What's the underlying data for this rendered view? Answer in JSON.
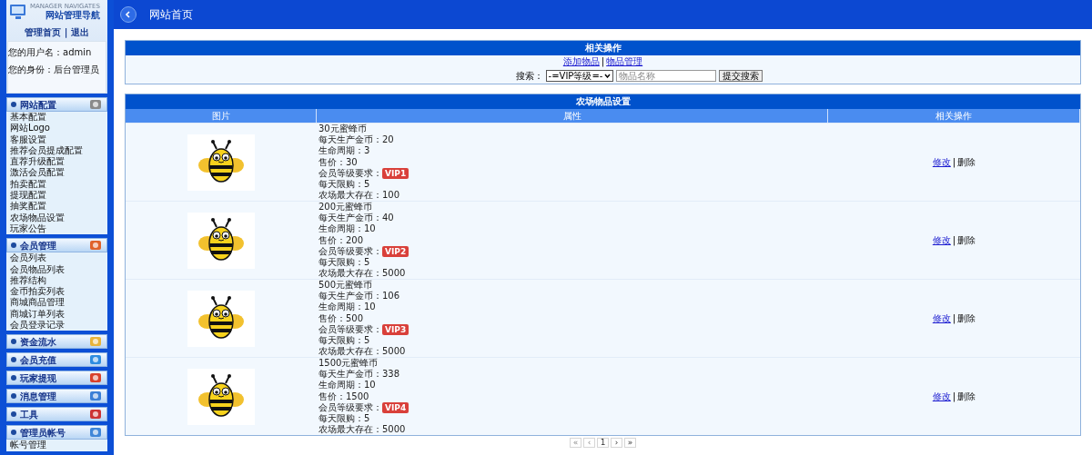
{
  "sidebar": {
    "subtitle": "MANAGER NAVIGATES",
    "title": "网站管理导航",
    "links": [
      "管理首页",
      "退出"
    ],
    "link_separator": "|",
    "user_lines": [
      "您的用户名：admin",
      "您的身份：后台管理员"
    ],
    "sections": [
      {
        "title": "网站配置",
        "items": [
          "基本配置",
          "网站Logo",
          "客服设置",
          "推荐会员提成配置",
          "直荐升级配置",
          "激活会员配置",
          "拍卖配置",
          "提现配置",
          "抽奖配置",
          "农场物品设置",
          "玩家公告"
        ]
      },
      {
        "title": "会员管理",
        "items": [
          "会员列表",
          "会员物品列表",
          "推荐结构",
          "金币拍卖列表",
          "商城商品管理",
          "商城订单列表",
          "会员登录记录"
        ]
      },
      {
        "title": "资金流水"
      },
      {
        "title": "会员充值"
      },
      {
        "title": "玩家提现"
      },
      {
        "title": "消息管理"
      },
      {
        "title": "工具"
      },
      {
        "title": "管理员帐号",
        "items": [
          "帐号管理"
        ]
      }
    ]
  },
  "header": {
    "title": "网站首页"
  },
  "operations": {
    "title": "相关操作",
    "links": [
      "添加物品",
      "物品管理"
    ],
    "link_separator": "|",
    "search_label": "搜索：",
    "select_value": "-=VIP等级=-",
    "search": {
      "placeholder": "物品名称"
    },
    "submit": "提交搜索"
  },
  "table": {
    "title": "农场物品设置",
    "columns": [
      "图片",
      "属性",
      "相关操作"
    ],
    "action_separator": "|",
    "rows": [
      {
        "lines": [
          {
            "kind": "text",
            "text": "30元蜜蜂币"
          },
          {
            "kind": "text",
            "text": "每天生产金币：20"
          },
          {
            "kind": "text",
            "text": "生命周期：3"
          },
          {
            "kind": "text",
            "text": "售价：30"
          },
          {
            "kind": "badge",
            "text": "会员等级要求：",
            "badge": "VIP1"
          },
          {
            "kind": "text",
            "text": "每天限购：5"
          },
          {
            "kind": "text",
            "text": "农场最大存在：100"
          }
        ],
        "actions": [
          {
            "kind": "link",
            "text": "修改"
          },
          {
            "kind": "text",
            "text": "删除"
          }
        ]
      },
      {
        "lines": [
          {
            "kind": "text",
            "text": "200元蜜蜂币"
          },
          {
            "kind": "text",
            "text": "每天生产金币：40"
          },
          {
            "kind": "text",
            "text": "生命周期：10"
          },
          {
            "kind": "text",
            "text": "售价：200"
          },
          {
            "kind": "badge",
            "text": "会员等级要求：",
            "badge": "VIP2"
          },
          {
            "kind": "text",
            "text": "每天限购：5"
          },
          {
            "kind": "text",
            "text": "农场最大存在：5000"
          }
        ],
        "actions": [
          {
            "kind": "link",
            "text": "修改"
          },
          {
            "kind": "text",
            "text": "删除"
          }
        ]
      },
      {
        "lines": [
          {
            "kind": "text",
            "text": "500元蜜蜂币"
          },
          {
            "kind": "text",
            "text": "每天生产金币：106"
          },
          {
            "kind": "text",
            "text": "生命周期：10"
          },
          {
            "kind": "text",
            "text": "售价：500"
          },
          {
            "kind": "badge",
            "text": "会员等级要求：",
            "badge": "VIP3"
          },
          {
            "kind": "text",
            "text": "每天限购：5"
          },
          {
            "kind": "text",
            "text": "农场最大存在：5000"
          }
        ],
        "actions": [
          {
            "kind": "link",
            "text": "修改"
          },
          {
            "kind": "text",
            "text": "删除"
          }
        ]
      },
      {
        "lines": [
          {
            "kind": "text",
            "text": "1500元蜜蜂币"
          },
          {
            "kind": "text",
            "text": "每天生产金币：338"
          },
          {
            "kind": "text",
            "text": "生命周期：10"
          },
          {
            "kind": "text",
            "text": "售价：1500"
          },
          {
            "kind": "badge",
            "text": "会员等级要求：",
            "badge": "VIP4"
          },
          {
            "kind": "text",
            "text": "每天限购：5"
          },
          {
            "kind": "text",
            "text": "农场最大存在：5000"
          }
        ],
        "actions": [
          {
            "kind": "link",
            "text": "修改"
          },
          {
            "kind": "text",
            "text": "删除"
          }
        ]
      }
    ]
  },
  "pagination": [
    {
      "text": "«",
      "disabled": true
    },
    {
      "text": "‹",
      "disabled": true
    },
    {
      "text": "1",
      "disabled": false
    },
    {
      "text": "›",
      "disabled": false
    },
    {
      "text": "»",
      "disabled": false
    }
  ]
}
